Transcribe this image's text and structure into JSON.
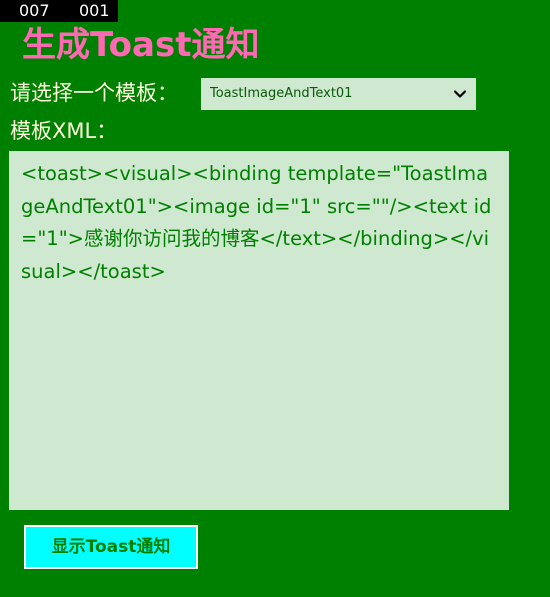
{
  "debug": {
    "counter_a": "007",
    "counter_b": "001"
  },
  "header": {
    "title": "生成Toast通知"
  },
  "template_picker": {
    "label": "请选择一个模板：",
    "selected_value": "ToastImageAndText01"
  },
  "xml_editor": {
    "label": "模板XML：",
    "content": "<toast><visual><binding template=\"ToastImageAndText01\"><image id=\"1\" src=\"\"/><text id=\"1\">感谢你访问我的博客</text></binding></visual></toast>"
  },
  "actions": {
    "show_toast_label": "显示Toast通知"
  },
  "colors": {
    "background": "#008000",
    "title": "#ff69b4",
    "label_text": "#ffffe0",
    "input_bg": "#cfe8d0",
    "button_bg": "#00ffff"
  },
  "icons": {
    "dropdown": "chevron-down-icon"
  }
}
